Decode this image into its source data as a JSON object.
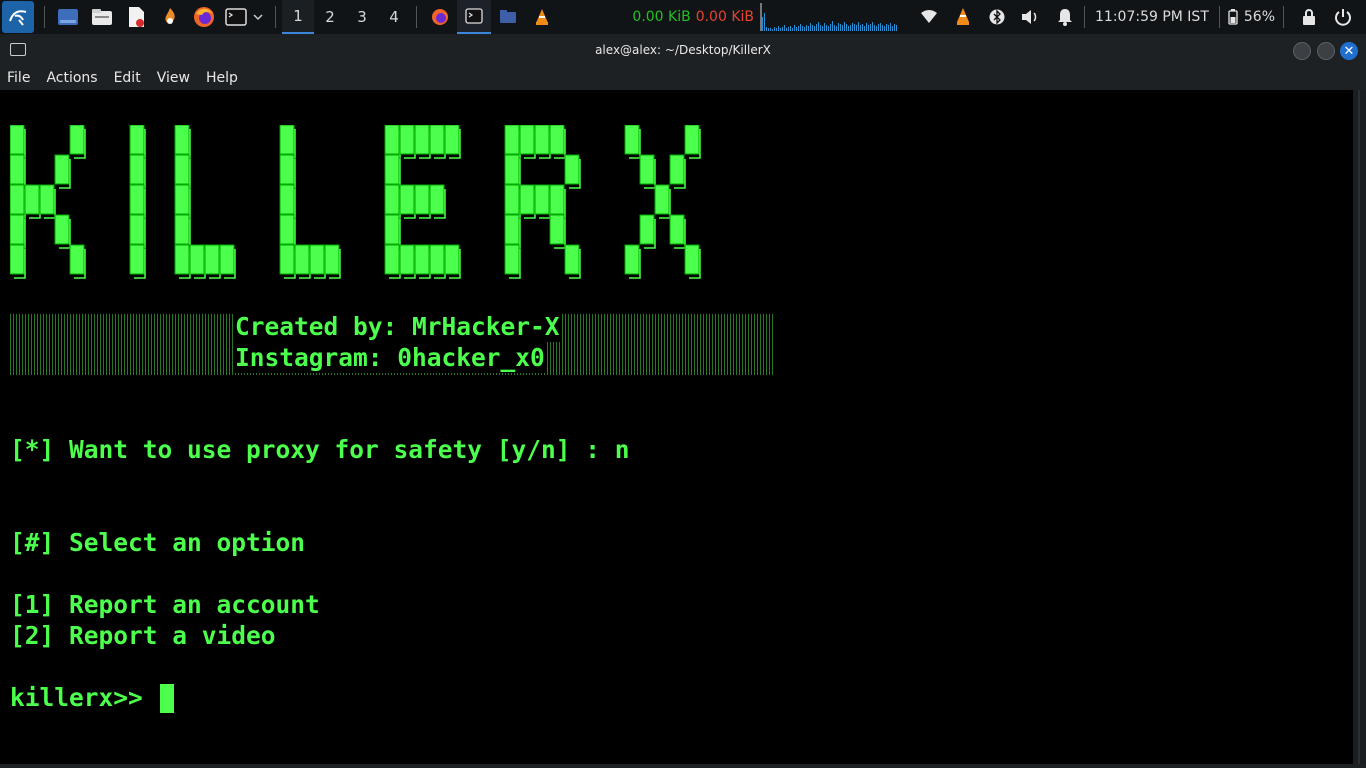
{
  "panel": {
    "workspaces": [
      "1",
      "2",
      "3",
      "4"
    ],
    "active_workspace": "1",
    "net_up": "0.00 KiB",
    "net_down": "0.00 KiB",
    "clock": "11:07:59 PM IST",
    "battery": "56%",
    "colors": {
      "accent": "#3b86d9",
      "net_up": "#22c022",
      "net_down": "#e6432e"
    }
  },
  "window": {
    "title": "alex@alex: ~/Desktop/KillerX"
  },
  "menu": {
    "items": [
      "File",
      "Actions",
      "Edit",
      "View",
      "Help"
    ]
  },
  "terminal": {
    "banner": {
      "word": "KILLERX",
      "color": "#4cff4c"
    },
    "credit_line1": "Created by: MrHacker-X",
    "credit_line2": "Instagram: 0hacker_x0",
    "proxy_prompt": "[*] Want to use proxy for safety [y/n] : n",
    "select_heading": "[#] Select an option",
    "option1": "[1] Report an account",
    "option2": "[2] Report a video",
    "prompt": "killerx>> "
  }
}
